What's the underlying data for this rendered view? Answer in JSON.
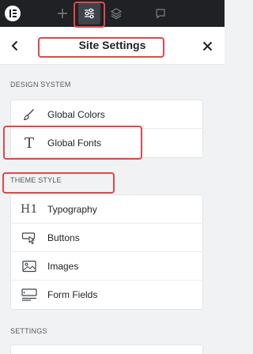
{
  "header": {
    "title": "Site Settings"
  },
  "sections": [
    {
      "label": "DESIGN SYSTEM",
      "items": [
        {
          "label": "Global Colors",
          "icon": "brush-icon"
        },
        {
          "label": "Global Fonts",
          "icon": "font-t-icon"
        }
      ]
    },
    {
      "label": "THEME STYLE",
      "items": [
        {
          "label": "Typography",
          "icon": "heading-h1-icon"
        },
        {
          "label": "Buttons",
          "icon": "button-pointer-icon"
        },
        {
          "label": "Images",
          "icon": "image-icon"
        },
        {
          "label": "Form Fields",
          "icon": "form-fields-icon"
        }
      ]
    },
    {
      "label": "SETTINGS",
      "items": []
    }
  ],
  "icons": {
    "font_t_glyph": "T",
    "heading_glyph": "H1"
  },
  "colors": {
    "toolbar_bg": "#1f2124",
    "highlight": "#e0484a",
    "panel_bg": "#f1f2f3"
  }
}
